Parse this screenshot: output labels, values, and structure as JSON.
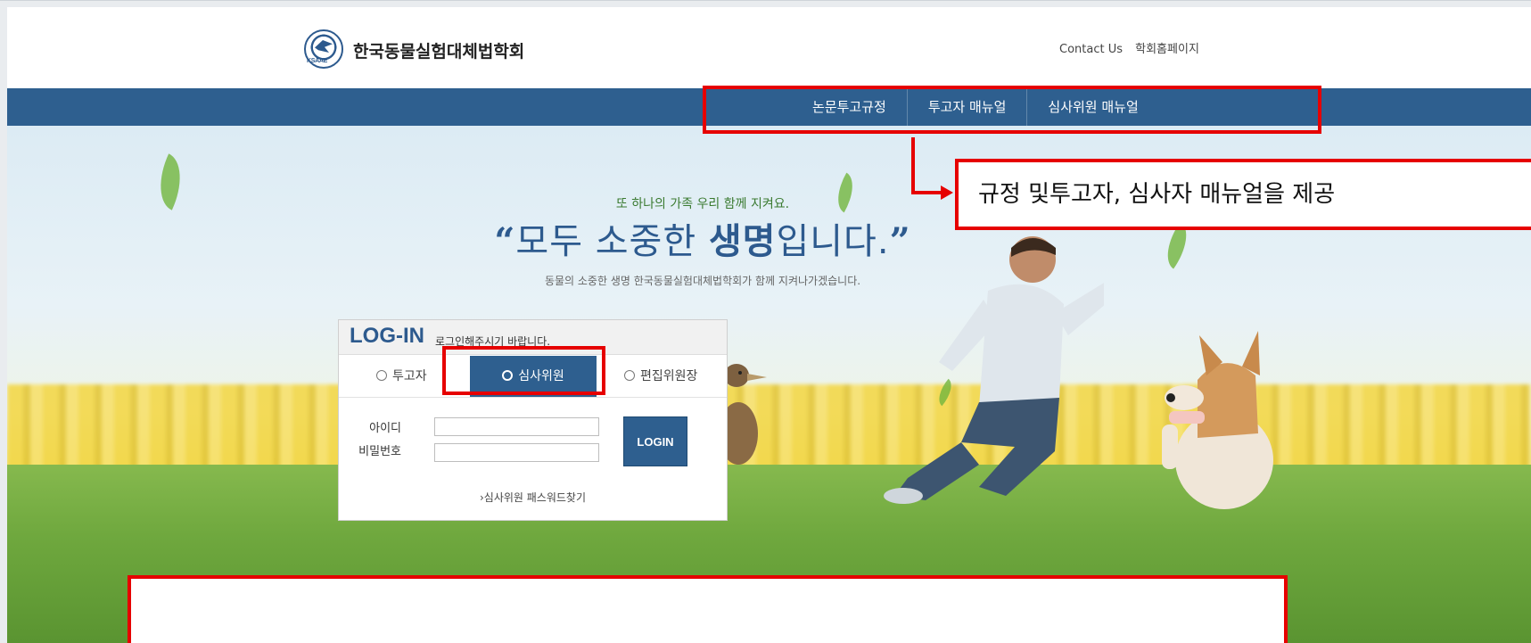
{
  "header": {
    "logo_abbr": "KSAAE",
    "site_name": "한국동물실험대체법학회",
    "top_links": [
      "Contact Us",
      "학회홈페이지"
    ]
  },
  "nav": {
    "items": [
      "논문투고규정",
      "투고자 매뉴얼",
      "심사위원 매뉴얼"
    ]
  },
  "hero": {
    "tagline_small": "또 하나의 가족 우리 함께 지켜요.",
    "tagline_open_quote": "“",
    "tagline_part1": "모두 소중한 ",
    "tagline_bold": "생명",
    "tagline_part2": "입니다.",
    "tagline_close_quote": "”",
    "tagline_sub": "동물의 소중한 생명 한국동물실험대체법학회가 함께 지켜나가겠습니다."
  },
  "login": {
    "title": "LOG-IN",
    "note": "로그인해주시기 바랍니다.",
    "roles": [
      "투고자",
      "심사위원",
      "편집위원장"
    ],
    "selected_role": "심사위원",
    "id_label": "아이디",
    "password_label": "비밀번호",
    "id_value": "",
    "password_value": "",
    "button_label": "LOGIN",
    "find_password": "›심사위원 패스워드찾기"
  },
  "annotation": {
    "callout_text": "규정 및투고자, 심사자 매뉴얼을 제공",
    "color": "#e60000"
  },
  "colors": {
    "brand_blue": "#2e5f8f",
    "accent_green": "#3a7a30"
  }
}
